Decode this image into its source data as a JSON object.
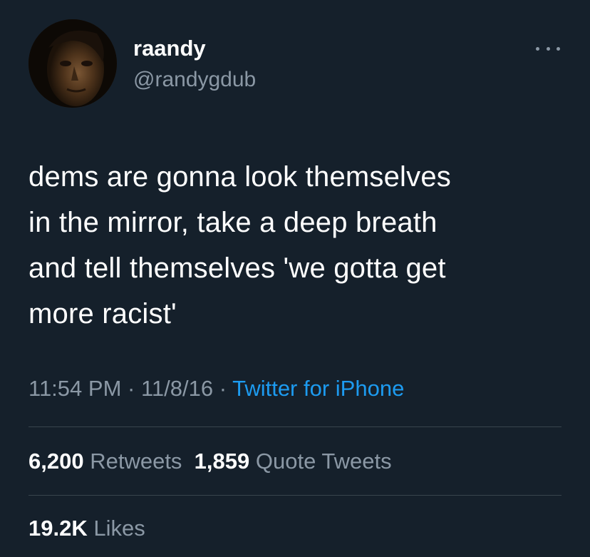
{
  "author": {
    "display_name": "raandy",
    "handle": "@randygdub",
    "avatar_icon": "profile-photo"
  },
  "more_icon": "more-horizontal-icon",
  "tweet": {
    "lines": [
      "dems are gonna look themselves",
      "in the mirror, take a deep breath",
      "and tell themselves 'we gotta get",
      "more racist'"
    ]
  },
  "meta": {
    "time": "11:54 PM",
    "sep1": " · ",
    "date": "11/8/16",
    "sep2": " · ",
    "source": "Twitter for iPhone"
  },
  "stats": {
    "retweets_count": "6,200",
    "retweets_label": "Retweets",
    "quotes_count": "1,859",
    "quotes_label": "Quote Tweets",
    "likes_count": "19.2K",
    "likes_label": "Likes"
  },
  "colors": {
    "background": "#15202b",
    "text": "#ffffff",
    "secondary": "#8b98a5",
    "link": "#1d9bf0",
    "divider": "#38444d"
  }
}
